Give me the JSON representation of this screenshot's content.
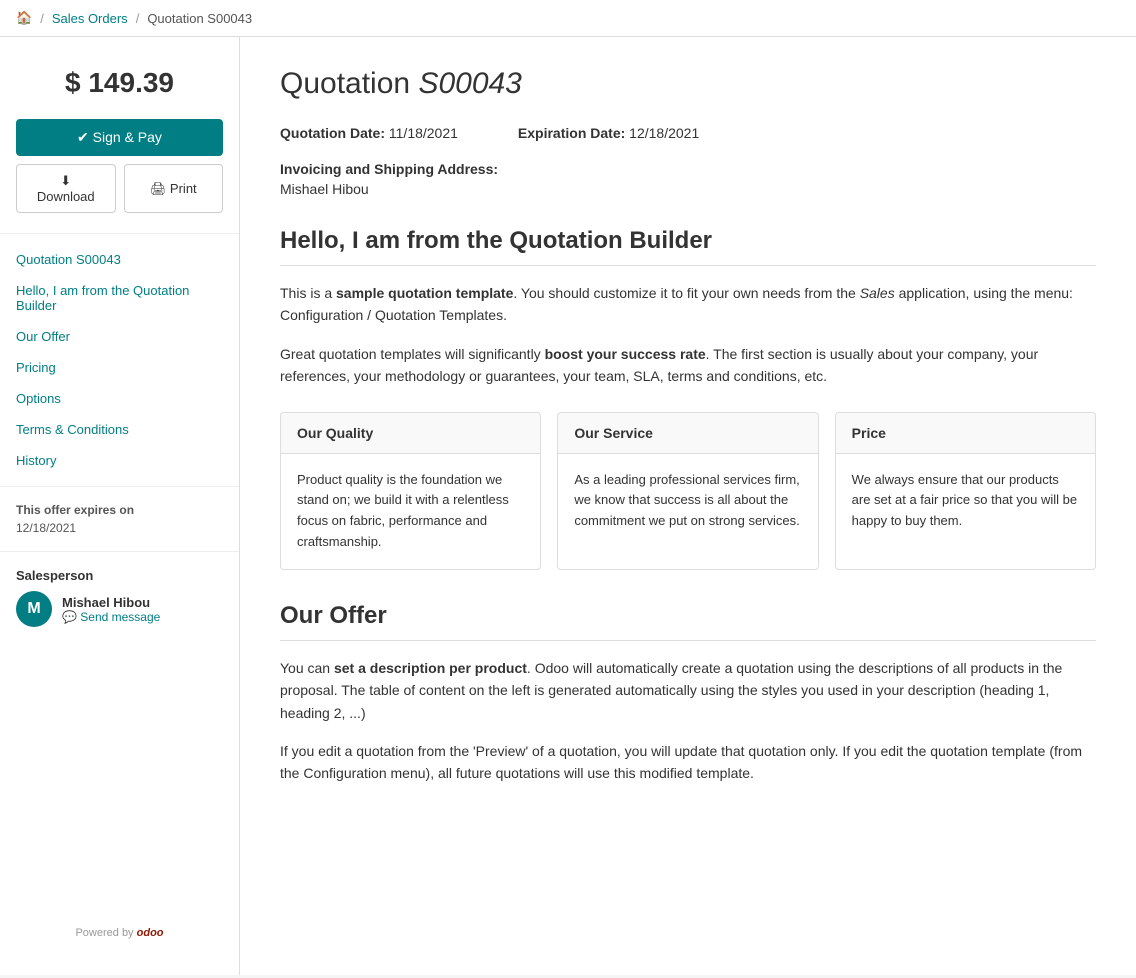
{
  "breadcrumb": {
    "home_icon": "home-icon",
    "home_label": "🏠",
    "sep1": "/",
    "sales_orders": "Sales Orders",
    "sep2": "/",
    "current": "Quotation S00043"
  },
  "sidebar": {
    "price": "$ 149.39",
    "sign_pay_label": "✔ Sign & Pay",
    "download_label": "⬇ Download",
    "print_label": "🖨 Print",
    "nav_items": [
      {
        "id": "quotation-s00043",
        "label": "Quotation S00043"
      },
      {
        "id": "hello-quotation-builder",
        "label": "Hello, I am from the Quotation Builder"
      },
      {
        "id": "our-offer",
        "label": "Our Offer"
      },
      {
        "id": "pricing",
        "label": "Pricing"
      },
      {
        "id": "options",
        "label": "Options"
      },
      {
        "id": "terms-conditions",
        "label": "Terms & Conditions"
      },
      {
        "id": "history",
        "label": "History"
      }
    ],
    "expiry_label": "This offer expires on",
    "expiry_date": "12/18/2021",
    "salesperson_label": "Salesperson",
    "salesperson_initial": "M",
    "salesperson_name": "Mishael Hibou",
    "send_message_label": "💬 Send message",
    "powered_by": "Powered by",
    "brand": "odoo"
  },
  "main": {
    "title_prefix": "Quotation ",
    "title_id": "S00043",
    "quotation_date_label": "Quotation Date:",
    "quotation_date_value": "11/18/2021",
    "expiration_date_label": "Expiration Date:",
    "expiration_date_value": "12/18/2021",
    "address_label": "Invoicing and Shipping Address:",
    "address_name": "Mishael Hibou",
    "section1_title": "Hello, I am from the Quotation Builder",
    "section1_para1_pre": "This is a ",
    "section1_para1_bold": "sample quotation template",
    "section1_para1_mid": ". You should customize it to fit your own needs from the ",
    "section1_para1_italic": "Sales",
    "section1_para1_post": " application, using the menu: Configuration / Quotation Templates.",
    "section1_para2_pre": "Great quotation templates will significantly ",
    "section1_para2_bold": "boost your success rate",
    "section1_para2_post": ". The first section is usually about your company, your references, your methodology or guarantees, your team, SLA, terms and conditions, etc.",
    "cards": [
      {
        "header": "Our Quality",
        "body": "Product quality is the foundation we stand on; we build it with a relentless focus on fabric, performance and craftsmanship."
      },
      {
        "header": "Our Service",
        "body": "As a leading professional services firm, we know that success is all about the commitment we put on strong services."
      },
      {
        "header": "Price",
        "body": "We always ensure that our products are set at a fair price so that you will be happy to buy them."
      }
    ],
    "section2_title": "Our Offer",
    "section2_para1_pre": "You can ",
    "section2_para1_bold": "set a description per product",
    "section2_para1_post": ". Odoo will automatically create a quotation using the descriptions of all products in the proposal. The table of content on the left is generated automatically using the styles you used in your description (heading 1, heading 2, ...)",
    "section2_para2": "If you edit a quotation from the 'Preview' of a quotation, you will update that quotation only. If you edit the quotation template (from the Configuration menu), all future quotations will use this modified template."
  }
}
